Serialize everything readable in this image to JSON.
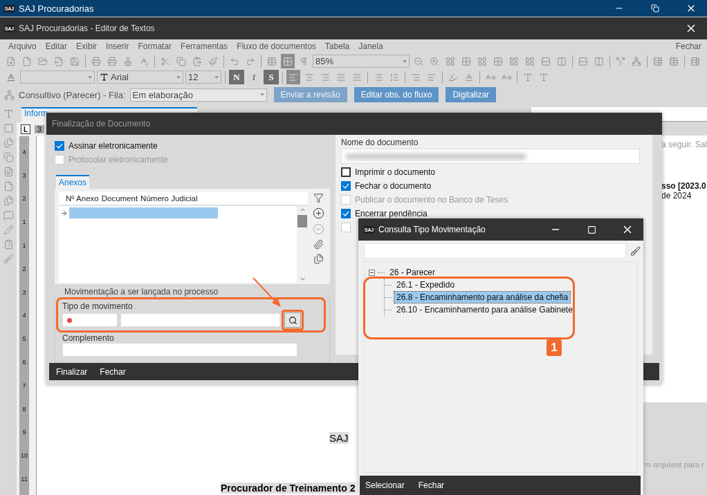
{
  "app_window": {
    "title": "SAJ Procuradorias",
    "logo": "SAJ"
  },
  "editor_window": {
    "title": "SAJ Procuradorias - Editor de Textos",
    "logo": "SAJ"
  },
  "menu": {
    "items": [
      "Arquivo",
      "Editar",
      "Exibir",
      "Inserir",
      "Formatar",
      "Ferramentas",
      "Fluxo de documentos",
      "Tabela",
      "Janela"
    ],
    "close": "Fechar"
  },
  "toolbar": {
    "zoom": "85%",
    "font": "Arial",
    "size": "12",
    "format_buttons": [
      {
        "label": "N",
        "pressed": true
      },
      {
        "label": "I",
        "pressed": false
      },
      {
        "label": "S",
        "pressed": true
      }
    ]
  },
  "flow_bar": {
    "label": "Consultivo (Parecer) - Fila:",
    "queue": "Em elaboração",
    "buttons": [
      {
        "label": "Enviar a revisão",
        "disabled": true
      },
      {
        "label": "Editar obs. do fluxo",
        "disabled": false
      },
      {
        "label": "Digitalizar",
        "disabled": false
      }
    ]
  },
  "document_tab": "Inform",
  "horizontal_ruler": {
    "tab_stop": "L",
    "mark": "3"
  },
  "vertical_ruler": [
    "4",
    "3",
    "2",
    "1",
    "1",
    "2",
    "3",
    "4",
    "5",
    "6",
    "7",
    "8",
    "9",
    "10",
    "11"
  ],
  "document_page": [
    "SAJ",
    "Procurador de Treinamento 2"
  ],
  "side_panel": [
    {
      "text": "a seguir. Sal",
      "kind": "hint"
    },
    {
      "text": "sso [2023.0",
      "kind": "bold"
    },
    {
      "text": "de 2024",
      "kind": "plain"
    },
    {
      "text": "m arquivos para r",
      "kind": "hint"
    }
  ],
  "finalization_dialog": {
    "title": "Finalização de Documento",
    "options": [
      {
        "label": "Assinar eletronicamente",
        "checked": true,
        "disabled": false
      },
      {
        "label": "Protocolar eletronicamente",
        "checked": false,
        "disabled": true
      }
    ],
    "attachments": {
      "tab": "Anexos",
      "columns": [
        "Nº Anexo",
        "Document",
        "Número Judicial"
      ],
      "rows": [
        {
          "selected": true
        }
      ]
    },
    "movement": {
      "legend": "Movimentação a ser lançada no processo",
      "type_label": "Tipo de movimento",
      "required": true,
      "complement_label": "Complemento"
    },
    "document_name_label": "Nome do documento",
    "document_options": [
      {
        "label": "Imprimir o documento",
        "checked": false,
        "disabled": false
      },
      {
        "label": "Fechar o documento",
        "checked": true,
        "disabled": false
      },
      {
        "label": "Publicar o documento no Banco de Teses",
        "checked": false,
        "disabled": true
      },
      {
        "label": "Encerrar pendência",
        "checked": true,
        "disabled": false
      },
      {
        "checked": false,
        "disabled": true
      }
    ],
    "footer": [
      "Finalizar",
      "Fechar"
    ]
  },
  "consult_dialog": {
    "title": "Consulta Tipo Movimentação",
    "logo": "SAJ",
    "tree": [
      {
        "label": "26 - Parecer",
        "expanded": true,
        "selected": false,
        "children": [
          {
            "label": "26.1 - Expedido",
            "selected": false
          },
          {
            "label": "26.8 - Encaminhamento para análise da chefia",
            "selected": true
          },
          {
            "label": "26.10 - Encaminhamento para análise Gabinete",
            "selected": false
          }
        ]
      }
    ],
    "footer": [
      "Selecionar",
      "Fechar"
    ]
  },
  "annotation": {
    "badge": "1"
  }
}
